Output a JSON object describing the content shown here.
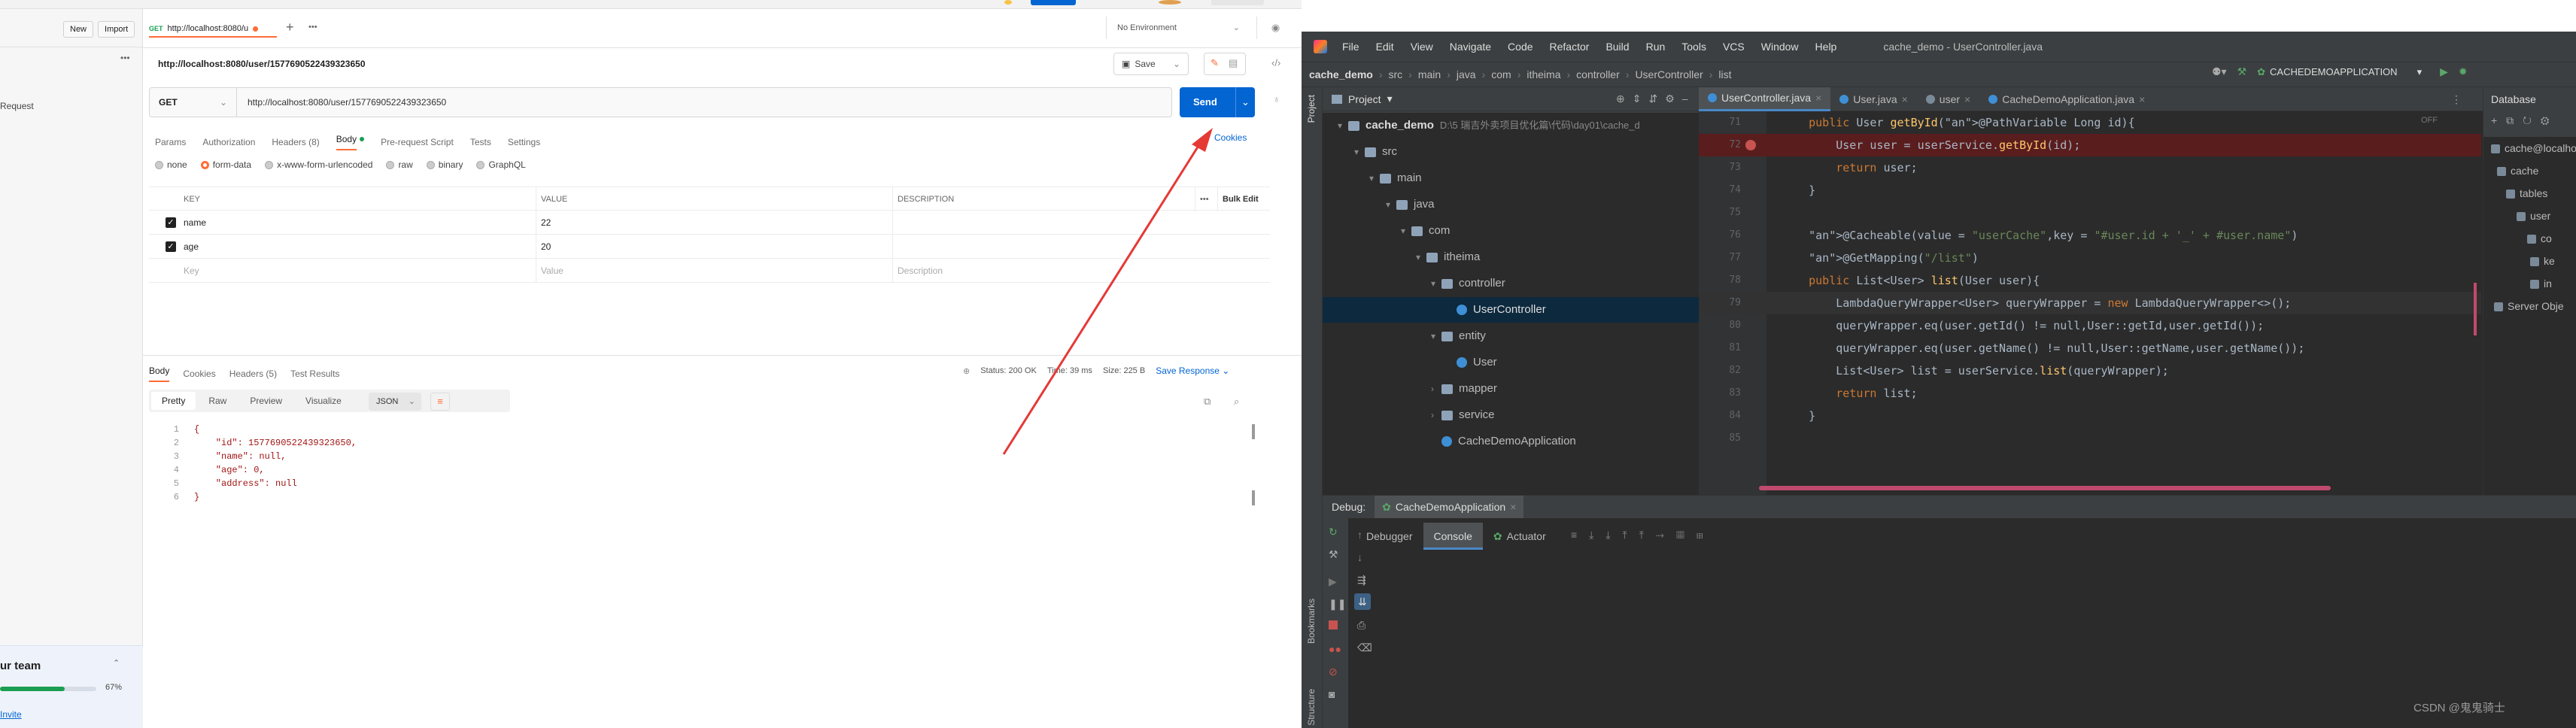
{
  "postman": {
    "sidebar": {
      "new_label": "New",
      "import_label": "Import",
      "request_label": "Request",
      "team_label": "ur team",
      "progress_label": "67%",
      "progress_value": 0.67,
      "invite_label": "Invite"
    },
    "tab": {
      "title": "http://localhost:8080/u",
      "add": "+",
      "more": "•••"
    },
    "environment": "No Environment",
    "request_title": "http://localhost:8080/user/1577690522439323650",
    "save_label": "Save",
    "method": "GET",
    "url": "http://localhost:8080/user/1577690522439323650",
    "send_label": "Send",
    "cookies_label": "Cookies",
    "request_tabs": [
      "Params",
      "Authorization",
      "Headers (8)",
      "Body",
      "Pre-request Script",
      "Tests",
      "Settings"
    ],
    "active_request_tab": "Body",
    "body_types": [
      "none",
      "form-data",
      "x-www-form-urlencoded",
      "raw",
      "binary",
      "GraphQL"
    ],
    "selected_body_type": "form-data",
    "table": {
      "headers": [
        "KEY",
        "VALUE",
        "DESCRIPTION"
      ],
      "more": "•••",
      "bulk_edit": "Bulk Edit",
      "rows": [
        {
          "key": "name",
          "value": "22",
          "description": ""
        },
        {
          "key": "age",
          "value": "20",
          "description": ""
        }
      ],
      "placeholder": {
        "key": "Key",
        "value": "Value",
        "description": "Description"
      }
    },
    "response": {
      "tabs": [
        "Body",
        "Cookies",
        "Headers (5)",
        "Test Results"
      ],
      "status": "Status: 200 OK",
      "time": "Time: 39 ms",
      "size": "Size: 225 B",
      "save_response": "Save Response",
      "view_modes": [
        "Pretty",
        "Raw",
        "Preview",
        "Visualize"
      ],
      "format": "JSON",
      "lines": [
        {
          "n": "1",
          "text": "{"
        },
        {
          "n": "2",
          "text": "    \"id\": 1577690522439323650,"
        },
        {
          "n": "3",
          "text": "    \"name\": null,"
        },
        {
          "n": "4",
          "text": "    \"age\": 0,"
        },
        {
          "n": "5",
          "text": "    \"address\": null"
        },
        {
          "n": "6",
          "text": "}"
        }
      ]
    }
  },
  "ide": {
    "menu": [
      "File",
      "Edit",
      "View",
      "Navigate",
      "Code",
      "Refactor",
      "Build",
      "Run",
      "Tools",
      "VCS",
      "Window",
      "Help"
    ],
    "window_title": "cache_demo - UserController.java",
    "breadcrumb": [
      "cache_demo",
      "src",
      "main",
      "java",
      "com",
      "itheima",
      "controller",
      "UserController",
      "list"
    ],
    "run_config": "CACHEDEMOAPPLICATION",
    "project_label": "Project",
    "editor_tabs": [
      "UserController.java",
      "User.java",
      "user",
      "CacheDemoApplication.java"
    ],
    "tree": [
      {
        "label": "cache_demo",
        "detail": "D:\\5 瑞吉外卖项目优化篇\\代码\\day01\\cache_d",
        "type": "folder"
      },
      {
        "label": "src",
        "type": "folder"
      },
      {
        "label": "main",
        "type": "folder"
      },
      {
        "label": "java",
        "type": "folder"
      },
      {
        "label": "com",
        "type": "folder"
      },
      {
        "label": "itheima",
        "type": "folder"
      },
      {
        "label": "controller",
        "type": "folder"
      },
      {
        "label": "UserController",
        "type": "class"
      },
      {
        "label": "entity",
        "type": "folder"
      },
      {
        "label": "User",
        "type": "class"
      },
      {
        "label": "mapper",
        "type": "folder"
      },
      {
        "label": "service",
        "type": "folder"
      },
      {
        "label": "CacheDemoApplication",
        "type": "class"
      }
    ],
    "off_label": "OFF",
    "code": [
      {
        "n": "71",
        "text": "    public User getById(@PathVariable Long id){"
      },
      {
        "n": "72",
        "text": "        User user = userService.getById(id);"
      },
      {
        "n": "73",
        "text": "        return user;"
      },
      {
        "n": "74",
        "text": "    }"
      },
      {
        "n": "75",
        "text": ""
      },
      {
        "n": "76",
        "text": "    @Cacheable(value = \"userCache\",key = \"#user.id + '_' + #user.name\")"
      },
      {
        "n": "77",
        "text": "    @GetMapping(\"/list\")"
      },
      {
        "n": "78",
        "text": "    public List<User> list(User user){"
      },
      {
        "n": "79",
        "text": "        LambdaQueryWrapper<User> queryWrapper = new LambdaQueryWrapper<>();"
      },
      {
        "n": "80",
        "text": "        queryWrapper.eq(user.getId() != null,User::getId,user.getId());"
      },
      {
        "n": "81",
        "text": "        queryWrapper.eq(user.getName() != null,User::getName,user.getName());"
      },
      {
        "n": "82",
        "text": "        List<User> list = userService.list(queryWrapper);"
      },
      {
        "n": "83",
        "text": "        return list;"
      },
      {
        "n": "84",
        "text": "    }"
      },
      {
        "n": "85",
        "text": ""
      }
    ],
    "database": {
      "title": "Database",
      "items": [
        "cache@localho",
        "cache",
        "tables",
        "user",
        "co",
        "ke",
        "in",
        "Server Obje"
      ]
    },
    "debug": {
      "label": "Debug:",
      "session": "CacheDemoApplication",
      "tabs": [
        "Debugger",
        "Console",
        "Actuator"
      ],
      "active_tab": "Console"
    },
    "side_tabs": [
      "Bookmarks",
      "Structure"
    ],
    "watermark": "CSDN @鬼鬼骑士"
  },
  "colors": {
    "postman_orange": "#ff6c37",
    "send_blue": "#0265d2",
    "ide_bg": "#2b2b2b",
    "breakpoint_line": "#5a1d1d",
    "annotation_arrow": "#e53935"
  }
}
